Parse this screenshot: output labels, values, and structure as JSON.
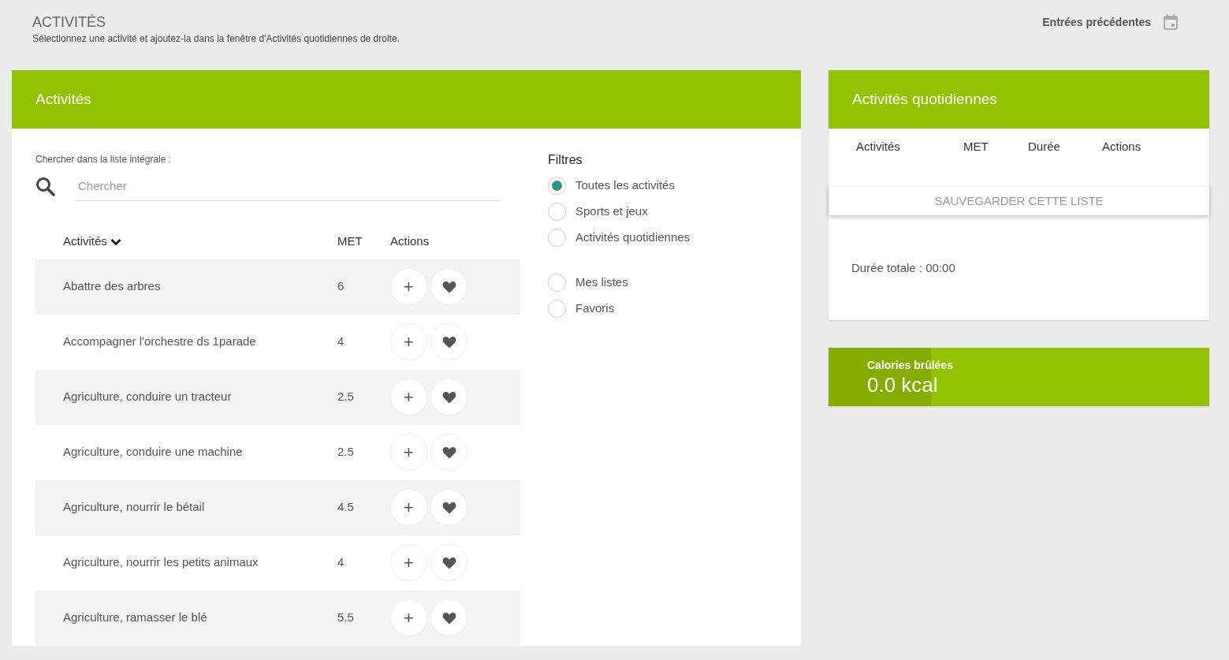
{
  "page": {
    "title": "ACTIVITÉS",
    "subtitle": "Sélectionnez une activité et ajoutez-la dans la fenêtre d'Activités quotidiennes de droite.",
    "previous_entries": "Entrées précédentes"
  },
  "activities_panel": {
    "title": "Activités",
    "search_label": "Chercher dans la liste intégrale :",
    "search": {
      "placeholder": "Chercher"
    },
    "columns": [
      "Activités",
      "MET",
      "Actions"
    ],
    "rows": [
      {
        "name": "Abattre des arbres",
        "met": "6",
        "add": "+"
      },
      {
        "name": "Accompagner l'orchestre ds 1parade",
        "met": "4",
        "add": "+"
      },
      {
        "name": "Agriculture, conduire un tracteur",
        "met": "2.5",
        "add": "+"
      },
      {
        "name": "Agriculture, conduire une machine",
        "met": "2.5",
        "add": "+"
      },
      {
        "name": "Agriculture, nourrir le bétail",
        "met": "4.5",
        "add": "+"
      },
      {
        "name": "Agriculture, nourrir les petits animaux",
        "met": "4",
        "add": "+"
      },
      {
        "name": "Agriculture, ramasser le blé",
        "met": "5.5",
        "add": "+"
      }
    ],
    "filters_title": "Filtres",
    "filters": [
      {
        "label": "Toutes les activités",
        "selected": true
      },
      {
        "label": "Sports et jeux",
        "selected": false
      },
      {
        "label": "Activités quotidiennes",
        "selected": false
      }
    ],
    "list_filters": [
      {
        "label": "Mes listes",
        "selected": false
      },
      {
        "label": "Favoris",
        "selected": false
      }
    ]
  },
  "daily_panel": {
    "title": "Activités quotidiennes",
    "columns": [
      "Activités",
      "MET",
      "Durée",
      "Actions"
    ],
    "save_button": "SAUVEGARDER CETTE LISTE",
    "total": "Durée totale : 00:00"
  },
  "calories": {
    "label": "Calories brûlées",
    "value": "0.0 kcal",
    "level": 0.27
  }
}
